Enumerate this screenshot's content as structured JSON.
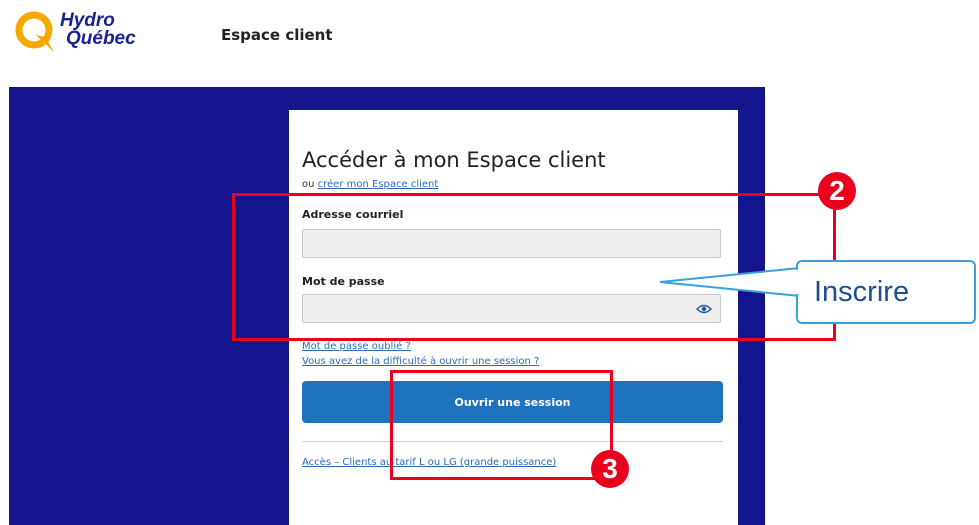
{
  "header": {
    "logo_line1": "Hydro",
    "logo_line2": "Québec",
    "nav_title": "Espace client"
  },
  "login": {
    "title": "Accéder à mon Espace client",
    "sub_prefix": "ou ",
    "create_link": "créer mon Espace client",
    "email_label": "Adresse courriel",
    "email_value": "",
    "password_label": "Mot de passe",
    "password_value": "",
    "forgot_link": "Mot de passe oublié ?",
    "difficulty_link": "Vous avez de la difficulté à ouvrir une session ?",
    "submit_label": "Ouvrir une session",
    "tariff_link": "Accès – Clients au tarif L ou LG (grande puissance)"
  },
  "annotations": {
    "badge_2": "2",
    "badge_3": "3",
    "callout_text": "Inscrire"
  },
  "colors": {
    "brand_navy": "#14148c",
    "button_blue": "#1e73be",
    "logo_yellow": "#f5a800",
    "annotation_red": "#e8001c",
    "callout_border": "#3aa0e0"
  },
  "icons": {
    "logo": "hydro-quebec-logo",
    "password_toggle": "eye-icon"
  }
}
